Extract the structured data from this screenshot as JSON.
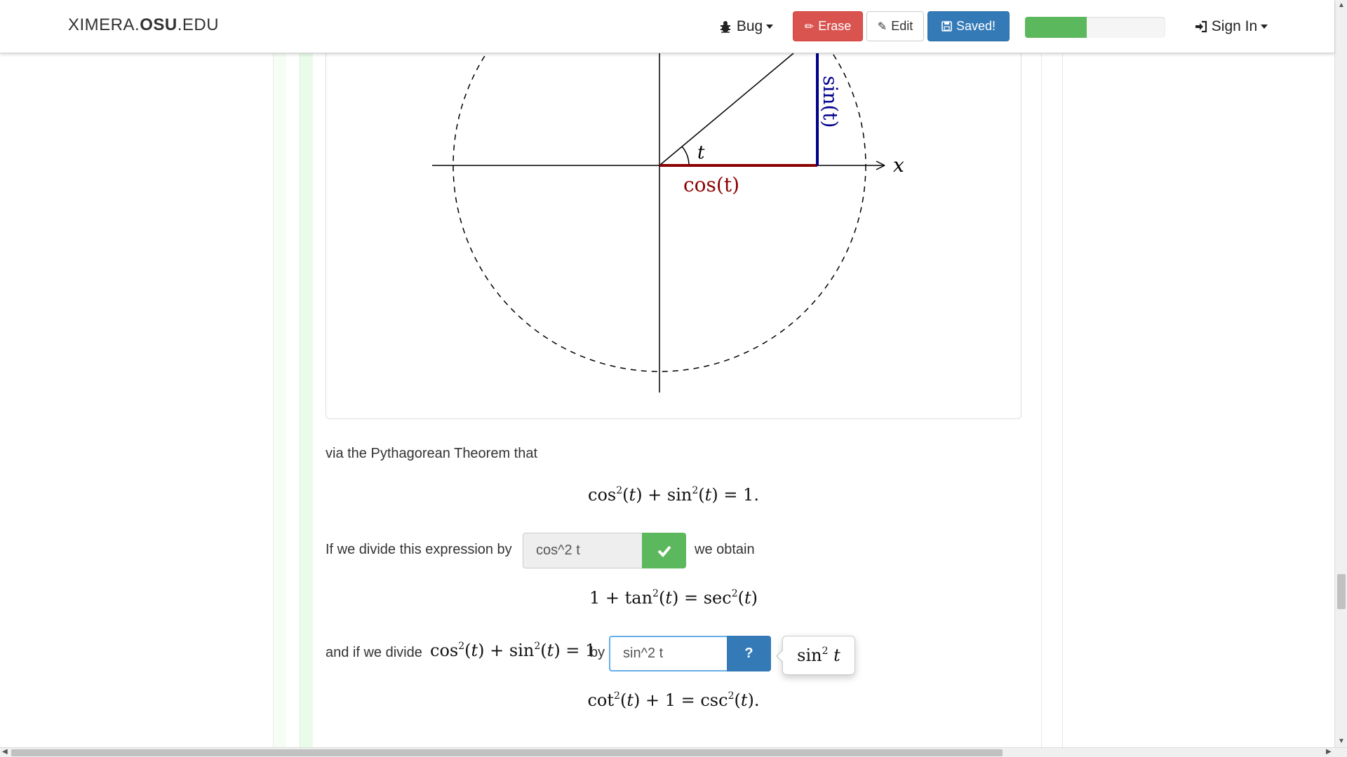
{
  "navbar": {
    "brand_prefix": "XIMERA.",
    "brand_bold": "OSU",
    "brand_suffix": ".EDU",
    "bug_label": "Bug",
    "erase_label": "Erase",
    "edit_label": "Edit",
    "saved_label": "Saved!",
    "progress_fraction": 0.44,
    "signin_label": "Sign In"
  },
  "figure": {
    "x_axis_label": "x",
    "angle_label": "t",
    "cos_label": "cos(t)",
    "sin_label": "sin(t)",
    "colors": {
      "cos": "#8b0000",
      "sin": "#00008b",
      "axis": "#000000"
    }
  },
  "content": {
    "para1": "via the Pythagorean Theorem that",
    "para2": "If we divide this expression by",
    "para2_after": "we obtain",
    "para3_before": "and if we divide",
    "para3_after": "by",
    "answer1_value": "cos^2 t",
    "answer2_value": "sin^2 t"
  },
  "colors": {
    "erase": "#d9534f",
    "saved": "#337ab7",
    "progress": "#5cb85c",
    "correct": "#5cb85c",
    "help": "#337ab7"
  }
}
